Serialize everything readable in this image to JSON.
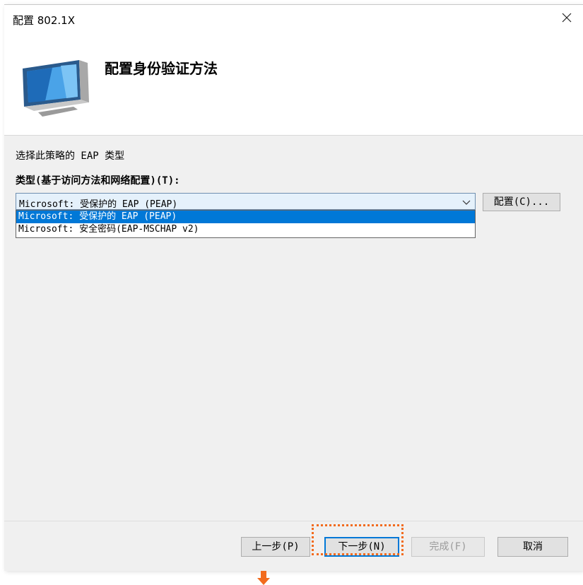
{
  "window": {
    "title": "配置 802.1X"
  },
  "header": {
    "title": "配置身份验证方法"
  },
  "body": {
    "instruction": "选择此策略的 EAP 类型",
    "type_label": "类型(基于访问方法和网络配置)(T):",
    "combo_value": "Microsoft: 受保护的 EAP (PEAP)",
    "dropdown_options": [
      "Microsoft: 受保护的 EAP (PEAP)",
      "Microsoft: 安全密码(EAP-MSCHAP v2)"
    ],
    "config_button": "配置(C)..."
  },
  "footer": {
    "back": "上一步(P)",
    "next": "下一步(N)",
    "finish": "完成(F)",
    "cancel": "取消"
  },
  "colors": {
    "highlight": "#f26b1d",
    "accent": "#0078d7"
  },
  "icons": [
    "close-icon",
    "computer-icon",
    "chevron-down-icon",
    "arrow-down-icon"
  ]
}
